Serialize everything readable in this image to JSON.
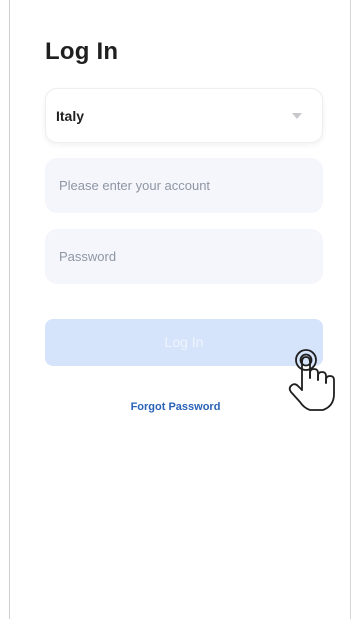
{
  "page": {
    "title": "Log In"
  },
  "country": {
    "value": "Italy"
  },
  "account": {
    "placeholder": "Please enter your account",
    "value": ""
  },
  "password": {
    "placeholder": "Password",
    "value": ""
  },
  "actions": {
    "login_label": "Log In",
    "forgot_label": "Forgot Password"
  },
  "icons": {
    "select_caret": "chevron-down-icon",
    "tap_indicator": "pointer-hand-icon"
  },
  "colors": {
    "title": "#1f1f1f",
    "field_bg": "#f4f6fb",
    "button_bg": "#d6e4fb",
    "link": "#2a62b8"
  }
}
